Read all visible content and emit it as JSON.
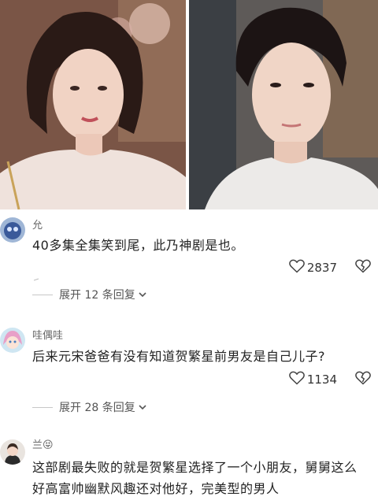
{
  "comments": [
    {
      "username": "允",
      "text": "40多集全集笑到尾，此乃神剧是也。",
      "likes": "2837",
      "replies_label": "展开 12 条回复"
    },
    {
      "username": "哇偶哇",
      "text": "后来元宋爸爸有没有知道贺繁星前男友是自己儿子?",
      "likes": "1134",
      "replies_label": "展开 28 条回复"
    },
    {
      "username": "兰",
      "username_emoji": "😝",
      "text": "这部剧最失败的就是贺繁星选择了一个小朋友，舅舅这么好高富帅幽默风趣还对他好，完美型的男人"
    }
  ],
  "icons": {
    "like": "heart-outline-icon",
    "dislike": "broken-heart-icon",
    "expand": "chevron-down-icon"
  }
}
